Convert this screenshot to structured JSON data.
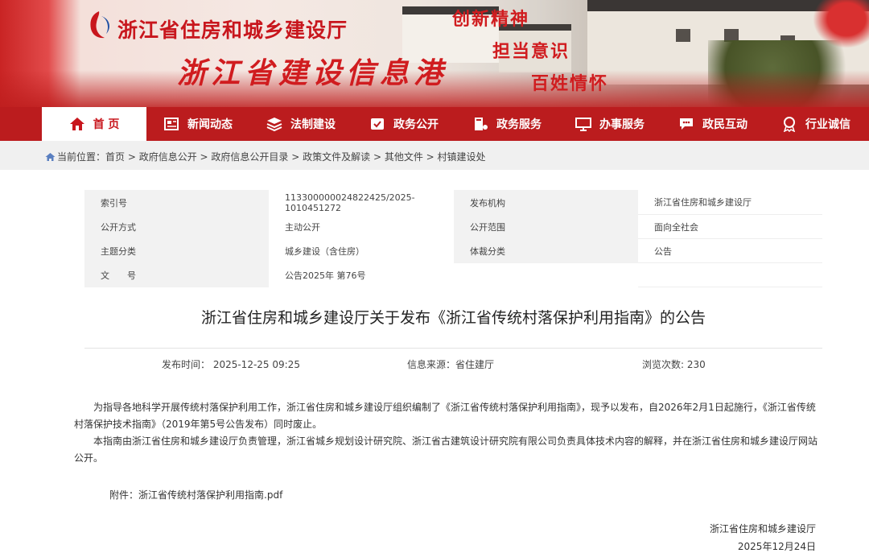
{
  "header": {
    "dept_name": "浙江省住房和城乡建设厅",
    "portal_name": "浙江省建设信息港",
    "slogans": [
      "创新精神",
      "担当意识",
      "百姓情怀"
    ]
  },
  "nav": {
    "items": [
      {
        "label": "首 页",
        "icon": "home-icon"
      },
      {
        "label": "新闻动态",
        "icon": "newspaper-icon"
      },
      {
        "label": "法制建设",
        "icon": "layers-icon"
      },
      {
        "label": "政务公开",
        "icon": "document-icon"
      },
      {
        "label": "政务服务",
        "icon": "service-icon"
      },
      {
        "label": "办事服务",
        "icon": "monitor-icon"
      },
      {
        "label": "政民互动",
        "icon": "chat-icon"
      },
      {
        "label": "行业诚信",
        "icon": "medal-icon"
      }
    ]
  },
  "breadcrumb": {
    "prefix": "当前位置：",
    "items": [
      "首页",
      "政府信息公开",
      "政府信息公开目录",
      "政策文件及解读",
      "其他文件",
      "村镇建设处"
    ],
    "separator": " > "
  },
  "meta": {
    "index_label": "索引号",
    "index_value": "113300000024822425/2025-1010451272",
    "publisher_label": "发布机构",
    "publisher_value": "浙江省住房和城乡建设厅",
    "method_label": "公开方式",
    "method_value": "主动公开",
    "scope_label": "公开范围",
    "scope_value": "面向全社会",
    "topic_label": "主题分类",
    "topic_value": "城乡建设（含住房）",
    "genre_label": "体裁分类",
    "genre_value": "公告",
    "docno_label": "文　　号",
    "docno_value": "公告2025年 第76号"
  },
  "article": {
    "title": "浙江省住房和城乡建设厅关于发布《浙江省传统村落保护利用指南》的公告",
    "publish_time": "发布时间：  2025-12-25 09:25",
    "source": "信息来源：省住建厅",
    "views": "浏览次数: 230",
    "para1": "为指导各地科学开展传统村落保护利用工作，浙江省住房和城乡建设厅组织编制了《浙江省传统村落保护利用指南》，现予以发布，自2026年2月1日起施行，《浙江省传统村落保护技术指南》（2019年第5号公告发布）同时废止。",
    "para2": "本指南由浙江省住房和城乡建设厅负责管理，浙江省城乡规划设计研究院、浙江省古建筑设计研究院有限公司负责具体技术内容的解释，并在浙江省住房和城乡建设厅网站公开。",
    "attachment_prefix": "附件：",
    "attachment_name": "浙江省传统村落保护利用指南.pdf",
    "signer": "浙江省住房和城乡建设厅",
    "sign_date": "2025年12月24日"
  },
  "colors": {
    "brand_red": "#bb1c1e",
    "title_red": "#c8161d"
  }
}
